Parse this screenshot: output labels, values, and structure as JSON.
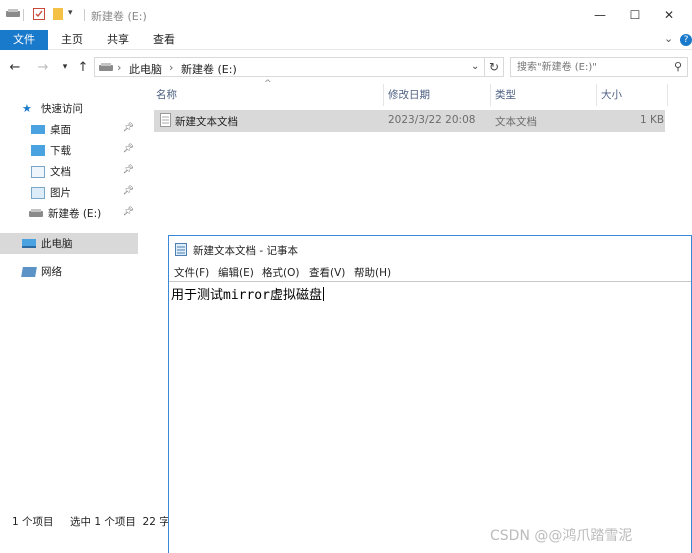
{
  "window": {
    "title": "新建卷 (E:)"
  },
  "ribbon": {
    "tabs": [
      "文件",
      "主页",
      "共享",
      "查看"
    ]
  },
  "address": {
    "path": [
      "此电脑",
      "新建卷 (E:)"
    ],
    "search_placeholder": "搜索\"新建卷 (E:)\""
  },
  "nav": {
    "quick_access": "快速访问",
    "items": [
      "桌面",
      "下载",
      "文档",
      "图片",
      "新建卷 (E:)"
    ],
    "this_pc": "此电脑",
    "network": "网络"
  },
  "columns": {
    "name": "名称",
    "modified": "修改日期",
    "type": "类型",
    "size": "大小"
  },
  "files": [
    {
      "name": "新建文本文档",
      "modified": "2023/3/22 20:08",
      "type": "文本文档",
      "size": "1 KB"
    }
  ],
  "status": {
    "count": "1 个项目",
    "selected": "选中 1 个项目  22 字"
  },
  "notepad": {
    "title": "新建文本文档 - 记事本",
    "menu": [
      "文件(F)",
      "编辑(E)",
      "格式(O)",
      "查看(V)",
      "帮助(H)"
    ],
    "content": "用于测试mirror虚拟磁盘"
  },
  "watermark": "CSDN @@鸿爪踏雪泥",
  "colors": {
    "accent": "#1979ca",
    "selection": "#d9d9d9",
    "notepad_border": "#3a88d8"
  }
}
